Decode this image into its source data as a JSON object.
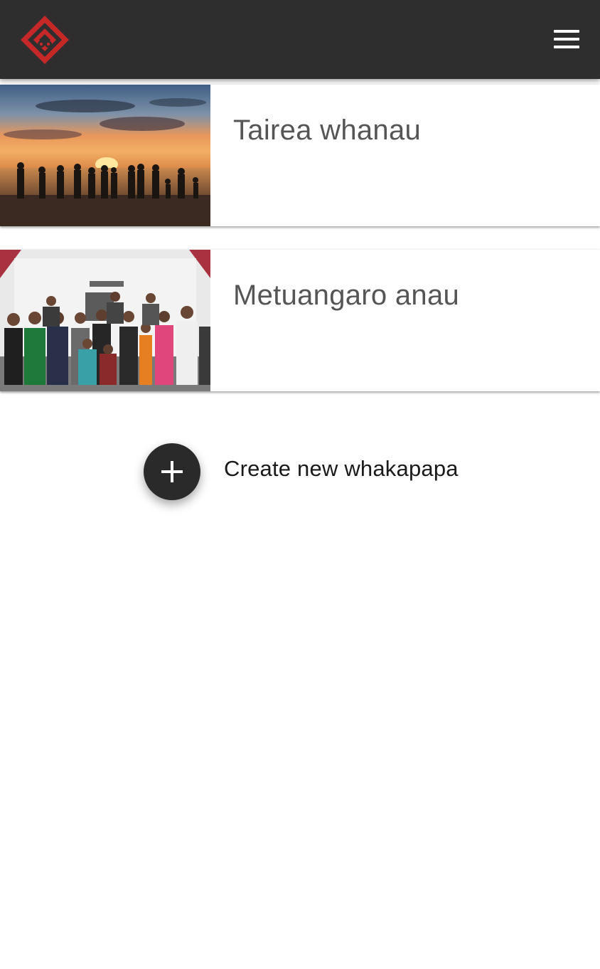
{
  "header": {
    "logo_icon": "diamond-house-logo-icon",
    "menu_icon": "hamburger-menu-icon",
    "background_color": "#2e2e2e",
    "logo_color": "#c62828"
  },
  "whakapapa_list": [
    {
      "title": "Tairea whanau",
      "image": "family-silhouette-sunset-photo"
    },
    {
      "title": "Metuangaro anau",
      "image": "family-group-photo-marae"
    }
  ],
  "create": {
    "label": "Create new whakapapa",
    "icon": "plus-icon"
  }
}
